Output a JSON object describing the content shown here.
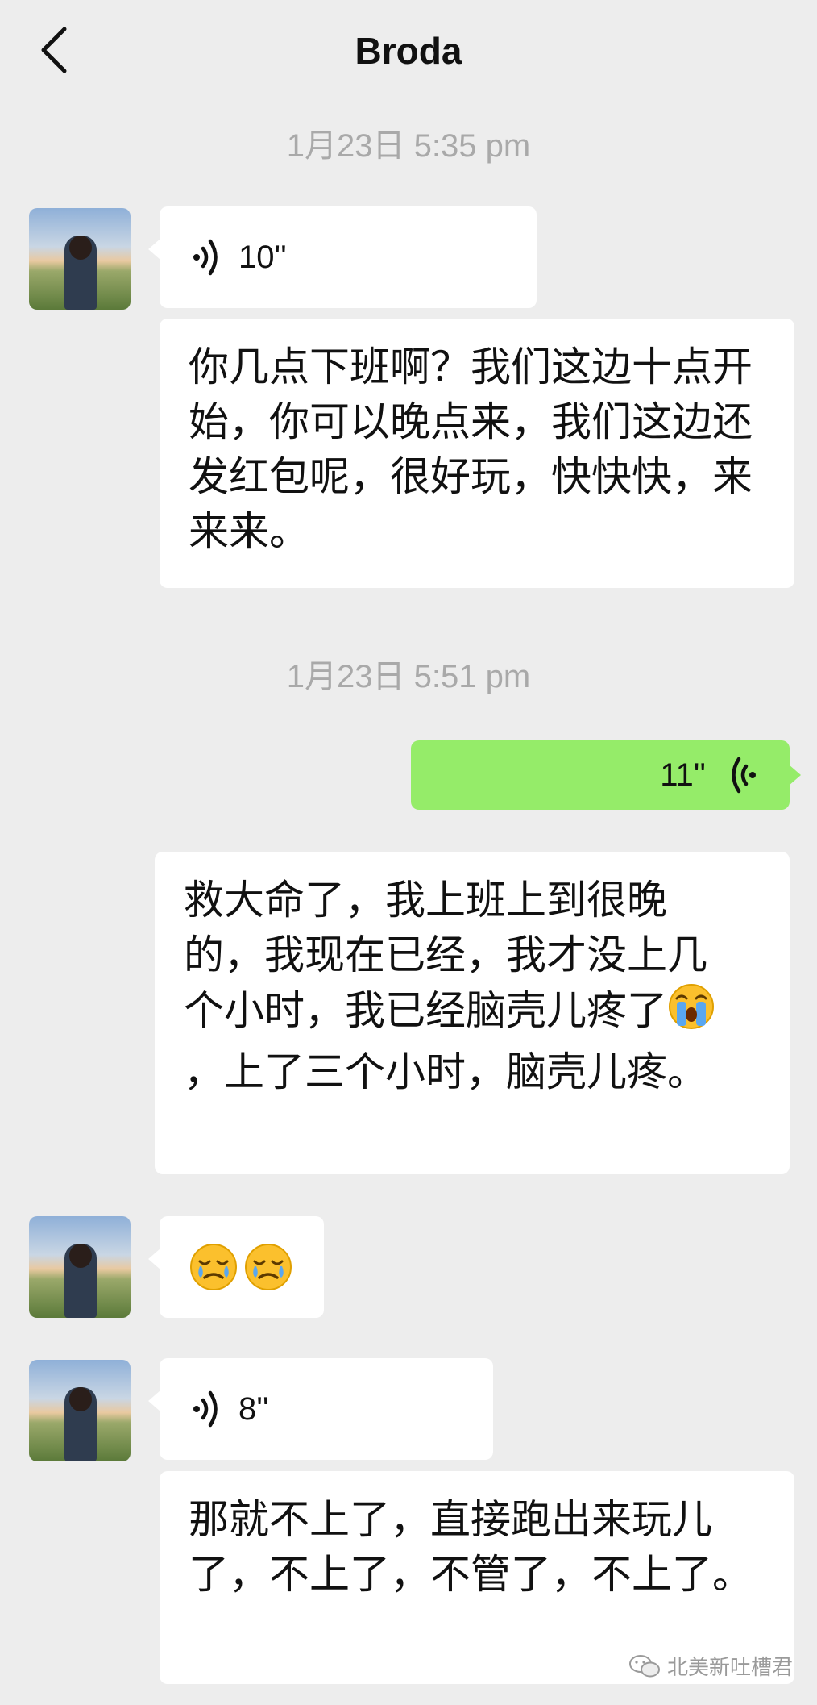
{
  "navbar": {
    "title": "Broda",
    "back_icon": "chevron-left-icon"
  },
  "messages": [
    {
      "type": "timestamp",
      "text": "1月23日 5:35 pm"
    },
    {
      "type": "voice",
      "from": "contact",
      "duration": "10''"
    },
    {
      "type": "text",
      "from": "contact",
      "text": "你几点下班啊？我们这边十点开始，你可以晚点来，我们这边还发红包呢，很好玩，快快快，来来来。"
    },
    {
      "type": "timestamp",
      "text": "1月23日 5:51 pm"
    },
    {
      "type": "voice",
      "from": "me",
      "duration": "11''"
    },
    {
      "type": "text",
      "from": "me",
      "text_before_emoji": "救大命了，我上班上到很晚的，我现在已经，我才没上几个小时，我已经脑壳儿疼了",
      "emoji": "loudly-crying-face",
      "text_after_emoji": "，上了三个小时，脑壳儿疼。"
    },
    {
      "type": "sticker",
      "from": "contact",
      "emojis": [
        "face-holding-back-tears",
        "face-holding-back-tears"
      ]
    },
    {
      "type": "voice",
      "from": "contact",
      "duration": "8''"
    },
    {
      "type": "text",
      "from": "contact",
      "text": "那就不上了，直接跑出来玩儿了，不上了，不管了，不上了。"
    }
  ],
  "watermark": {
    "text": "北美新吐槽君",
    "icon": "wechat-icon"
  },
  "colors": {
    "background": "#ededed",
    "sent_bubble": "#95ec69",
    "received_bubble": "#ffffff",
    "timestamp": "#a9a9a9"
  }
}
